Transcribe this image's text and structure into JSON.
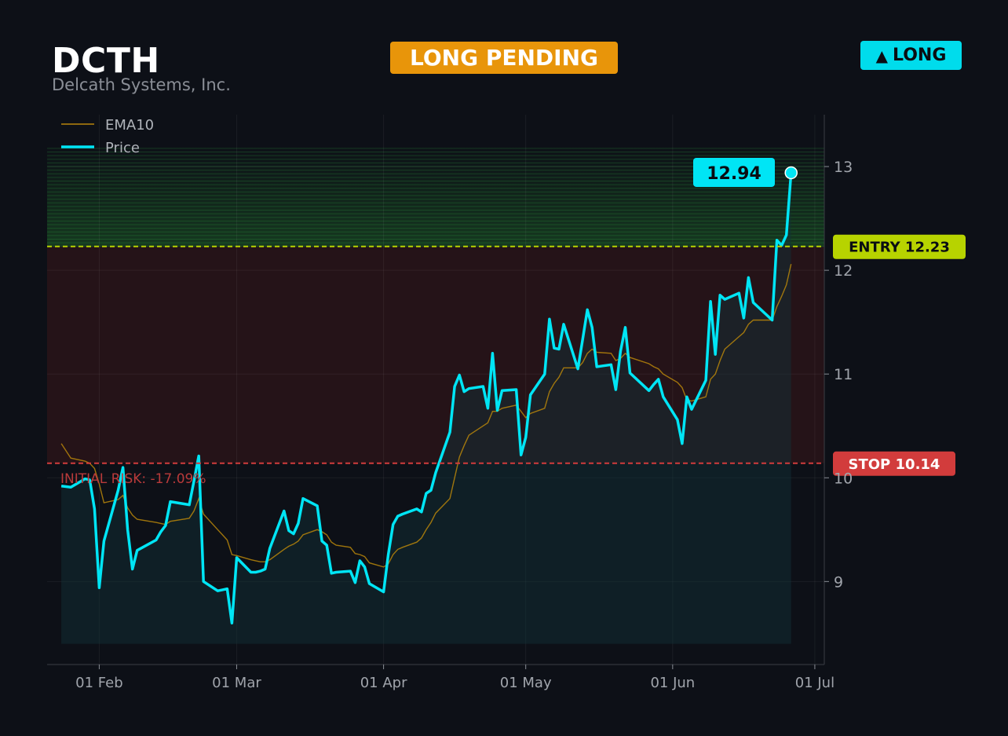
{
  "header": {
    "ticker": "DCTH",
    "company": "Delcath Systems, Inc.",
    "status": "LONG PENDING",
    "direction_icon": "up-triangle-icon",
    "direction_arrow": "▲",
    "direction": "LONG"
  },
  "colors": {
    "background": "#0d1017",
    "price": "#00e5f5",
    "ema": "#b8860b",
    "entry": "#b7d300",
    "stop": "#d23c3c",
    "status_badge": "#e8950a",
    "direction_badge": "#00dcec",
    "target_zone": "#1f6b2a",
    "risk_zone": "#2a1419"
  },
  "chart_data": {
    "type": "line",
    "x_tick_labels": [
      "01 Feb",
      "01 Mar",
      "01 Apr",
      "01 May",
      "01 Jun",
      "01 Jul"
    ],
    "x_tick_dates": [
      "2024-02-01",
      "2024-03-01",
      "2024-04-01",
      "2024-05-01",
      "2024-06-01",
      "2024-07-01"
    ],
    "xlim": [
      "2024-01-21",
      "2024-07-03"
    ],
    "y_ticks": [
      9,
      10,
      11,
      12,
      13
    ],
    "ylim": [
      8.2,
      13.5
    ],
    "grid": true,
    "legend_position": "top-left",
    "legend": [
      {
        "name": "EMA10",
        "series": "ema10"
      },
      {
        "name": "Price",
        "series": "price"
      }
    ],
    "series": [
      {
        "name": "Price",
        "key": "price",
        "points": [
          [
            "2024-01-24",
            9.92
          ],
          [
            "2024-01-26",
            9.91
          ],
          [
            "2024-01-29",
            9.99
          ],
          [
            "2024-01-30",
            9.98
          ],
          [
            "2024-01-31",
            9.7
          ],
          [
            "2024-02-01",
            8.94
          ],
          [
            "2024-02-02",
            9.39
          ],
          [
            "2024-02-05",
            9.88
          ],
          [
            "2024-02-06",
            10.1
          ],
          [
            "2024-02-07",
            9.5
          ],
          [
            "2024-02-08",
            9.12
          ],
          [
            "2024-02-09",
            9.3
          ],
          [
            "2024-02-13",
            9.4
          ],
          [
            "2024-02-14",
            9.48
          ],
          [
            "2024-02-15",
            9.54
          ],
          [
            "2024-02-16",
            9.77
          ],
          [
            "2024-02-20",
            9.74
          ],
          [
            "2024-02-21",
            9.97
          ],
          [
            "2024-02-22",
            10.21
          ],
          [
            "2024-02-23",
            9.0
          ],
          [
            "2024-02-26",
            8.91
          ],
          [
            "2024-02-27",
            8.92
          ],
          [
            "2024-02-28",
            8.93
          ],
          [
            "2024-02-29",
            8.6
          ],
          [
            "2024-03-01",
            9.23
          ],
          [
            "2024-03-04",
            9.09
          ],
          [
            "2024-03-05",
            9.09
          ],
          [
            "2024-03-06",
            9.1
          ],
          [
            "2024-03-07",
            9.12
          ],
          [
            "2024-03-08",
            9.32
          ],
          [
            "2024-03-11",
            9.68
          ],
          [
            "2024-03-12",
            9.49
          ],
          [
            "2024-03-13",
            9.46
          ],
          [
            "2024-03-14",
            9.56
          ],
          [
            "2024-03-15",
            9.8
          ],
          [
            "2024-03-18",
            9.73
          ],
          [
            "2024-03-19",
            9.39
          ],
          [
            "2024-03-20",
            9.35
          ],
          [
            "2024-03-21",
            9.08
          ],
          [
            "2024-03-22",
            9.09
          ],
          [
            "2024-03-25",
            9.1
          ],
          [
            "2024-03-26",
            8.99
          ],
          [
            "2024-03-27",
            9.2
          ],
          [
            "2024-03-28",
            9.14
          ],
          [
            "2024-03-29",
            8.98
          ],
          [
            "2024-04-01",
            8.9
          ],
          [
            "2024-04-02",
            9.26
          ],
          [
            "2024-04-03",
            9.55
          ],
          [
            "2024-04-04",
            9.63
          ],
          [
            "2024-04-05",
            9.65
          ],
          [
            "2024-04-08",
            9.7
          ],
          [
            "2024-04-09",
            9.67
          ],
          [
            "2024-04-10",
            9.85
          ],
          [
            "2024-04-11",
            9.88
          ],
          [
            "2024-04-12",
            10.05
          ],
          [
            "2024-04-15",
            10.44
          ],
          [
            "2024-04-16",
            10.88
          ],
          [
            "2024-04-17",
            10.99
          ],
          [
            "2024-04-18",
            10.83
          ],
          [
            "2024-04-19",
            10.86
          ],
          [
            "2024-04-22",
            10.88
          ],
          [
            "2024-04-23",
            10.67
          ],
          [
            "2024-04-24",
            11.2
          ],
          [
            "2024-04-25",
            10.65
          ],
          [
            "2024-04-26",
            10.84
          ],
          [
            "2024-04-29",
            10.85
          ],
          [
            "2024-04-30",
            10.22
          ],
          [
            "2024-05-01",
            10.39
          ],
          [
            "2024-05-02",
            10.8
          ],
          [
            "2024-05-05",
            11.0
          ],
          [
            "2024-05-06",
            11.53
          ],
          [
            "2024-05-07",
            11.25
          ],
          [
            "2024-05-08",
            11.24
          ],
          [
            "2024-05-09",
            11.48
          ],
          [
            "2024-05-12",
            11.05
          ],
          [
            "2024-05-13",
            11.33
          ],
          [
            "2024-05-14",
            11.62
          ],
          [
            "2024-05-15",
            11.45
          ],
          [
            "2024-05-16",
            11.07
          ],
          [
            "2024-05-19",
            11.09
          ],
          [
            "2024-05-20",
            10.85
          ],
          [
            "2024-05-21",
            11.22
          ],
          [
            "2024-05-22",
            11.45
          ],
          [
            "2024-05-23",
            11.01
          ],
          [
            "2024-05-27",
            10.84
          ],
          [
            "2024-05-28",
            10.9
          ],
          [
            "2024-05-29",
            10.95
          ],
          [
            "2024-05-30",
            10.78
          ],
          [
            "2024-06-02",
            10.56
          ],
          [
            "2024-06-03",
            10.33
          ],
          [
            "2024-06-04",
            10.78
          ],
          [
            "2024-06-05",
            10.66
          ],
          [
            "2024-06-08",
            10.94
          ],
          [
            "2024-06-09",
            11.7
          ],
          [
            "2024-06-10",
            11.19
          ],
          [
            "2024-06-11",
            11.76
          ],
          [
            "2024-06-12",
            11.72
          ],
          [
            "2024-06-15",
            11.78
          ],
          [
            "2024-06-16",
            11.54
          ],
          [
            "2024-06-17",
            11.93
          ],
          [
            "2024-06-18",
            11.69
          ],
          [
            "2024-06-22",
            11.52
          ],
          [
            "2024-06-23",
            12.29
          ],
          [
            "2024-06-24",
            12.24
          ],
          [
            "2024-06-25",
            12.34
          ],
          [
            "2024-06-26",
            12.94
          ]
        ]
      },
      {
        "name": "EMA10",
        "key": "ema10",
        "points": [
          [
            "2024-01-24",
            10.33
          ],
          [
            "2024-01-26",
            10.19
          ],
          [
            "2024-01-29",
            10.16
          ],
          [
            "2024-01-30",
            10.14
          ],
          [
            "2024-01-31",
            10.09
          ],
          [
            "2024-02-01",
            9.94
          ],
          [
            "2024-02-02",
            9.76
          ],
          [
            "2024-02-05",
            9.79
          ],
          [
            "2024-02-06",
            9.83
          ],
          [
            "2024-02-07",
            9.71
          ],
          [
            "2024-02-08",
            9.64
          ],
          [
            "2024-02-09",
            9.6
          ],
          [
            "2024-02-13",
            9.57
          ],
          [
            "2024-02-14",
            9.56
          ],
          [
            "2024-02-15",
            9.55
          ],
          [
            "2024-02-16",
            9.58
          ],
          [
            "2024-02-20",
            9.61
          ],
          [
            "2024-02-21",
            9.68
          ],
          [
            "2024-02-22",
            9.8
          ],
          [
            "2024-02-23",
            9.65
          ],
          [
            "2024-02-26",
            9.5
          ],
          [
            "2024-02-27",
            9.45
          ],
          [
            "2024-02-28",
            9.4
          ],
          [
            "2024-02-29",
            9.26
          ],
          [
            "2024-03-01",
            9.25
          ],
          [
            "2024-03-04",
            9.21
          ],
          [
            "2024-03-05",
            9.2
          ],
          [
            "2024-03-06",
            9.19
          ],
          [
            "2024-03-07",
            9.19
          ],
          [
            "2024-03-08",
            9.21
          ],
          [
            "2024-03-11",
            9.31
          ],
          [
            "2024-03-12",
            9.34
          ],
          [
            "2024-03-13",
            9.36
          ],
          [
            "2024-03-14",
            9.39
          ],
          [
            "2024-03-15",
            9.45
          ],
          [
            "2024-03-18",
            9.5
          ],
          [
            "2024-03-19",
            9.48
          ],
          [
            "2024-03-20",
            9.45
          ],
          [
            "2024-03-21",
            9.38
          ],
          [
            "2024-03-22",
            9.35
          ],
          [
            "2024-03-25",
            9.33
          ],
          [
            "2024-03-26",
            9.27
          ],
          [
            "2024-03-27",
            9.26
          ],
          [
            "2024-03-28",
            9.24
          ],
          [
            "2024-03-29",
            9.18
          ],
          [
            "2024-04-01",
            9.14
          ],
          [
            "2024-04-02",
            9.17
          ],
          [
            "2024-04-03",
            9.26
          ],
          [
            "2024-04-04",
            9.31
          ],
          [
            "2024-04-05",
            9.33
          ],
          [
            "2024-04-08",
            9.38
          ],
          [
            "2024-04-09",
            9.42
          ],
          [
            "2024-04-10",
            9.5
          ],
          [
            "2024-04-11",
            9.57
          ],
          [
            "2024-04-12",
            9.66
          ],
          [
            "2024-04-15",
            9.8
          ],
          [
            "2024-04-16",
            10.0
          ],
          [
            "2024-04-17",
            10.2
          ],
          [
            "2024-04-18",
            10.31
          ],
          [
            "2024-04-19",
            10.41
          ],
          [
            "2024-04-22",
            10.5
          ],
          [
            "2024-04-23",
            10.53
          ],
          [
            "2024-04-24",
            10.64
          ],
          [
            "2024-04-25",
            10.64
          ],
          [
            "2024-04-26",
            10.67
          ],
          [
            "2024-04-29",
            10.7
          ],
          [
            "2024-04-30",
            10.64
          ],
          [
            "2024-05-01",
            10.58
          ],
          [
            "2024-05-02",
            10.62
          ],
          [
            "2024-05-05",
            10.67
          ],
          [
            "2024-05-06",
            10.83
          ],
          [
            "2024-05-07",
            10.91
          ],
          [
            "2024-05-08",
            10.97
          ],
          [
            "2024-05-09",
            11.06
          ],
          [
            "2024-05-12",
            11.06
          ],
          [
            "2024-05-13",
            11.11
          ],
          [
            "2024-05-14",
            11.2
          ],
          [
            "2024-05-15",
            11.24
          ],
          [
            "2024-05-16",
            11.21
          ],
          [
            "2024-05-19",
            11.2
          ],
          [
            "2024-05-20",
            11.13
          ],
          [
            "2024-05-21",
            11.15
          ],
          [
            "2024-05-22",
            11.2
          ],
          [
            "2024-05-23",
            11.16
          ],
          [
            "2024-05-27",
            11.1
          ],
          [
            "2024-05-28",
            11.07
          ],
          [
            "2024-05-29",
            11.05
          ],
          [
            "2024-05-30",
            11.0
          ],
          [
            "2024-06-02",
            10.92
          ],
          [
            "2024-06-03",
            10.87
          ],
          [
            "2024-06-04",
            10.75
          ],
          [
            "2024-06-05",
            10.74
          ],
          [
            "2024-06-08",
            10.78
          ],
          [
            "2024-06-09",
            10.95
          ],
          [
            "2024-06-10",
            11.0
          ],
          [
            "2024-06-11",
            11.13
          ],
          [
            "2024-06-12",
            11.24
          ],
          [
            "2024-06-15",
            11.36
          ],
          [
            "2024-06-16",
            11.4
          ],
          [
            "2024-06-17",
            11.48
          ],
          [
            "2024-06-18",
            11.52
          ],
          [
            "2024-06-22",
            11.52
          ],
          [
            "2024-06-23",
            11.65
          ],
          [
            "2024-06-24",
            11.75
          ],
          [
            "2024-06-25",
            11.86
          ],
          [
            "2024-06-26",
            12.06
          ]
        ]
      }
    ],
    "last_price_label": "12.94",
    "entry": {
      "value": 12.23,
      "label": "ENTRY 12.23"
    },
    "stop": {
      "value": 10.14,
      "label": "STOP 10.14"
    },
    "risk_label": "INITIAL RISK: -17.09%",
    "target_zone": [
      12.23,
      13.2
    ],
    "base_fill_floor": 8.4
  }
}
